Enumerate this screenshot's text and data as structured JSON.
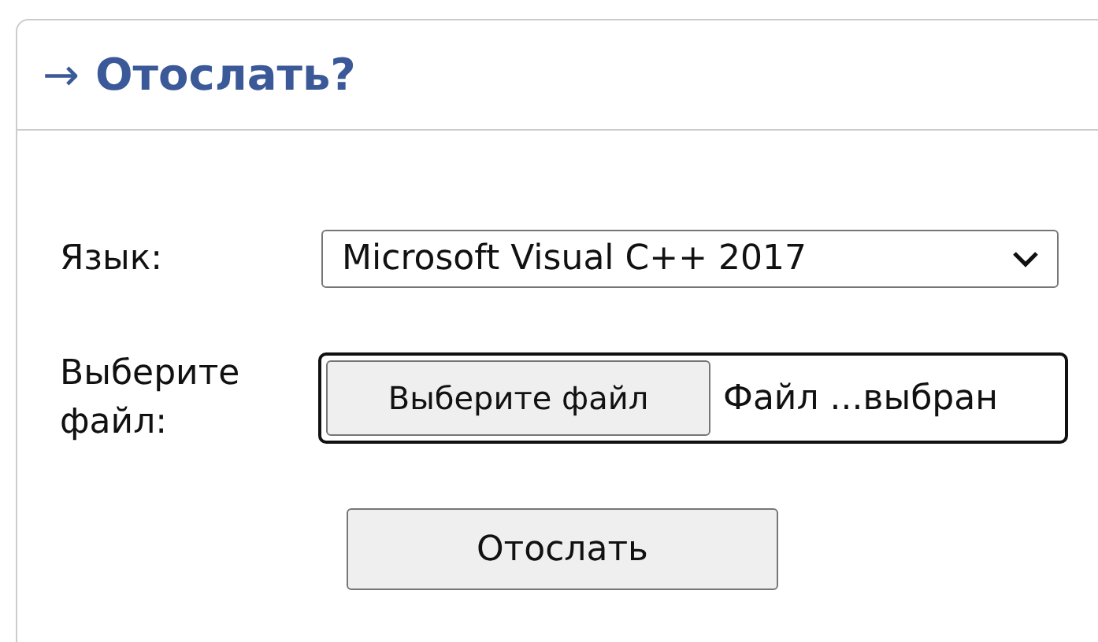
{
  "panel": {
    "arrow": "→",
    "title": "Отослать?"
  },
  "fields": [
    {
      "kind": "select",
      "label": "Язык:",
      "value": "Microsoft Visual C++ 2017"
    },
    {
      "kind": "file",
      "label": "Выберите файл:",
      "button": "Выберите файл",
      "value": "Файл ...выбран"
    }
  ],
  "submit": "Отослать"
}
